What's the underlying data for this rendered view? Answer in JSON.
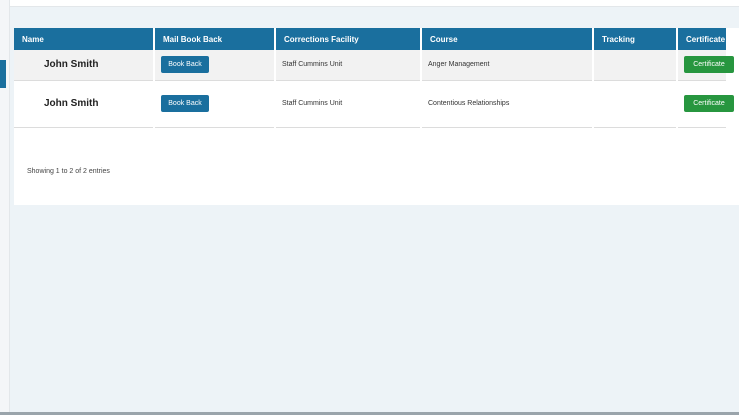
{
  "table": {
    "columns": [
      "Name",
      "Mail Book Back",
      "Corrections Facility",
      "Course",
      "Tracking",
      "Certificate"
    ],
    "rows": [
      {
        "name": "John Smith",
        "book_back_label": "Book Back",
        "facility": "Staff Cummins Unit",
        "course": "Anger Management",
        "tracking": "",
        "certificate_label": "Certificate"
      },
      {
        "name": "John Smith",
        "book_back_label": "Book Back",
        "facility": "Staff Cummins Unit",
        "course": "Contentious Relationships",
        "tracking": "",
        "certificate_label": "Certificate"
      }
    ]
  },
  "footer": {
    "info": "Showing 1 to 2 of 2 entries"
  },
  "colors": {
    "header": "#1a6f9e",
    "book_button": "#1a6f9e",
    "certificate_button": "#27963f",
    "background": "#edf3f7"
  }
}
